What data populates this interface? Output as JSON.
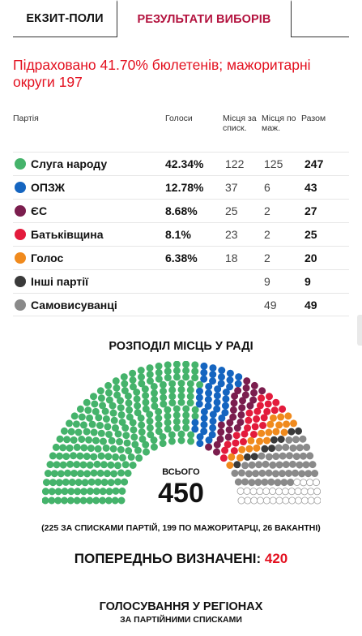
{
  "tabs": {
    "exit_polls": "ЕКЗИТ-ПОЛИ",
    "results": "РЕЗУЛЬТАТИ ВИБОРІВ"
  },
  "counted_text": "Підраховано 41.70% бюлетенів; мажоритарні округи 197",
  "table": {
    "headers": {
      "party": "Партія",
      "votes": "Голоси",
      "list": "Місця за списк.",
      "maj": "Місця по маж.",
      "total": "Разом"
    },
    "rows": [
      {
        "name": "Слуга народу",
        "votes": "42.34%",
        "list": "122",
        "maj": "125",
        "total": "247",
        "color": "#45b36b"
      },
      {
        "name": "ОПЗЖ",
        "votes": "12.78%",
        "list": "37",
        "maj": "6",
        "total": "43",
        "color": "#1565c0"
      },
      {
        "name": "ЄС",
        "votes": "8.68%",
        "list": "25",
        "maj": "2",
        "total": "27",
        "color": "#7b1e4e"
      },
      {
        "name": "Батьківщина",
        "votes": "8.1%",
        "list": "23",
        "maj": "2",
        "total": "25",
        "color": "#e31b3c"
      },
      {
        "name": "Голос",
        "votes": "6.38%",
        "list": "18",
        "maj": "2",
        "total": "20",
        "color": "#f08a1d"
      },
      {
        "name": "Інші партії",
        "votes": "",
        "list": "",
        "maj": "9",
        "total": "9",
        "color": "#3a3a3a"
      },
      {
        "name": "Самовисуванці",
        "votes": "",
        "list": "",
        "maj": "49",
        "total": "49",
        "color": "#8a8a8a"
      }
    ]
  },
  "distribution": {
    "title": "РОЗПОДІЛ МІСЦЬ У РАДІ",
    "total_label": "ВСЬОГО",
    "total_number": "450",
    "seats": [
      {
        "party": "Слуга народу",
        "count": 247,
        "color": "#45b36b"
      },
      {
        "party": "ОПЗЖ",
        "count": 43,
        "color": "#1565c0"
      },
      {
        "party": "ЄС",
        "count": 27,
        "color": "#7b1e4e"
      },
      {
        "party": "Батьківщина",
        "count": 25,
        "color": "#e31b3c"
      },
      {
        "party": "Голос",
        "count": 20,
        "color": "#f08a1d"
      },
      {
        "party": "Інші партії",
        "count": 9,
        "color": "#3a3a3a"
      },
      {
        "party": "Самовисуванці",
        "count": 49,
        "color": "#8a8a8a"
      }
    ],
    "vacant_count": 30,
    "vacant_color": "#ffffff",
    "breakdown": "(225 ЗА СПИСКАМИ ПАРТІЙ, 199 ПО МАЖОРИТАРЦІ, 26 ВАКАНТНІ)",
    "prelim_label": "ПОПЕРЕДНЬО ВИЗНАЧЕНІ:",
    "prelim_value": "420"
  },
  "regions": {
    "title": "ГОЛОСУВАННЯ У РЕГІОНАХ",
    "subtitle": "ЗА ПАРТІЙНИМИ СПИСКАМИ"
  }
}
